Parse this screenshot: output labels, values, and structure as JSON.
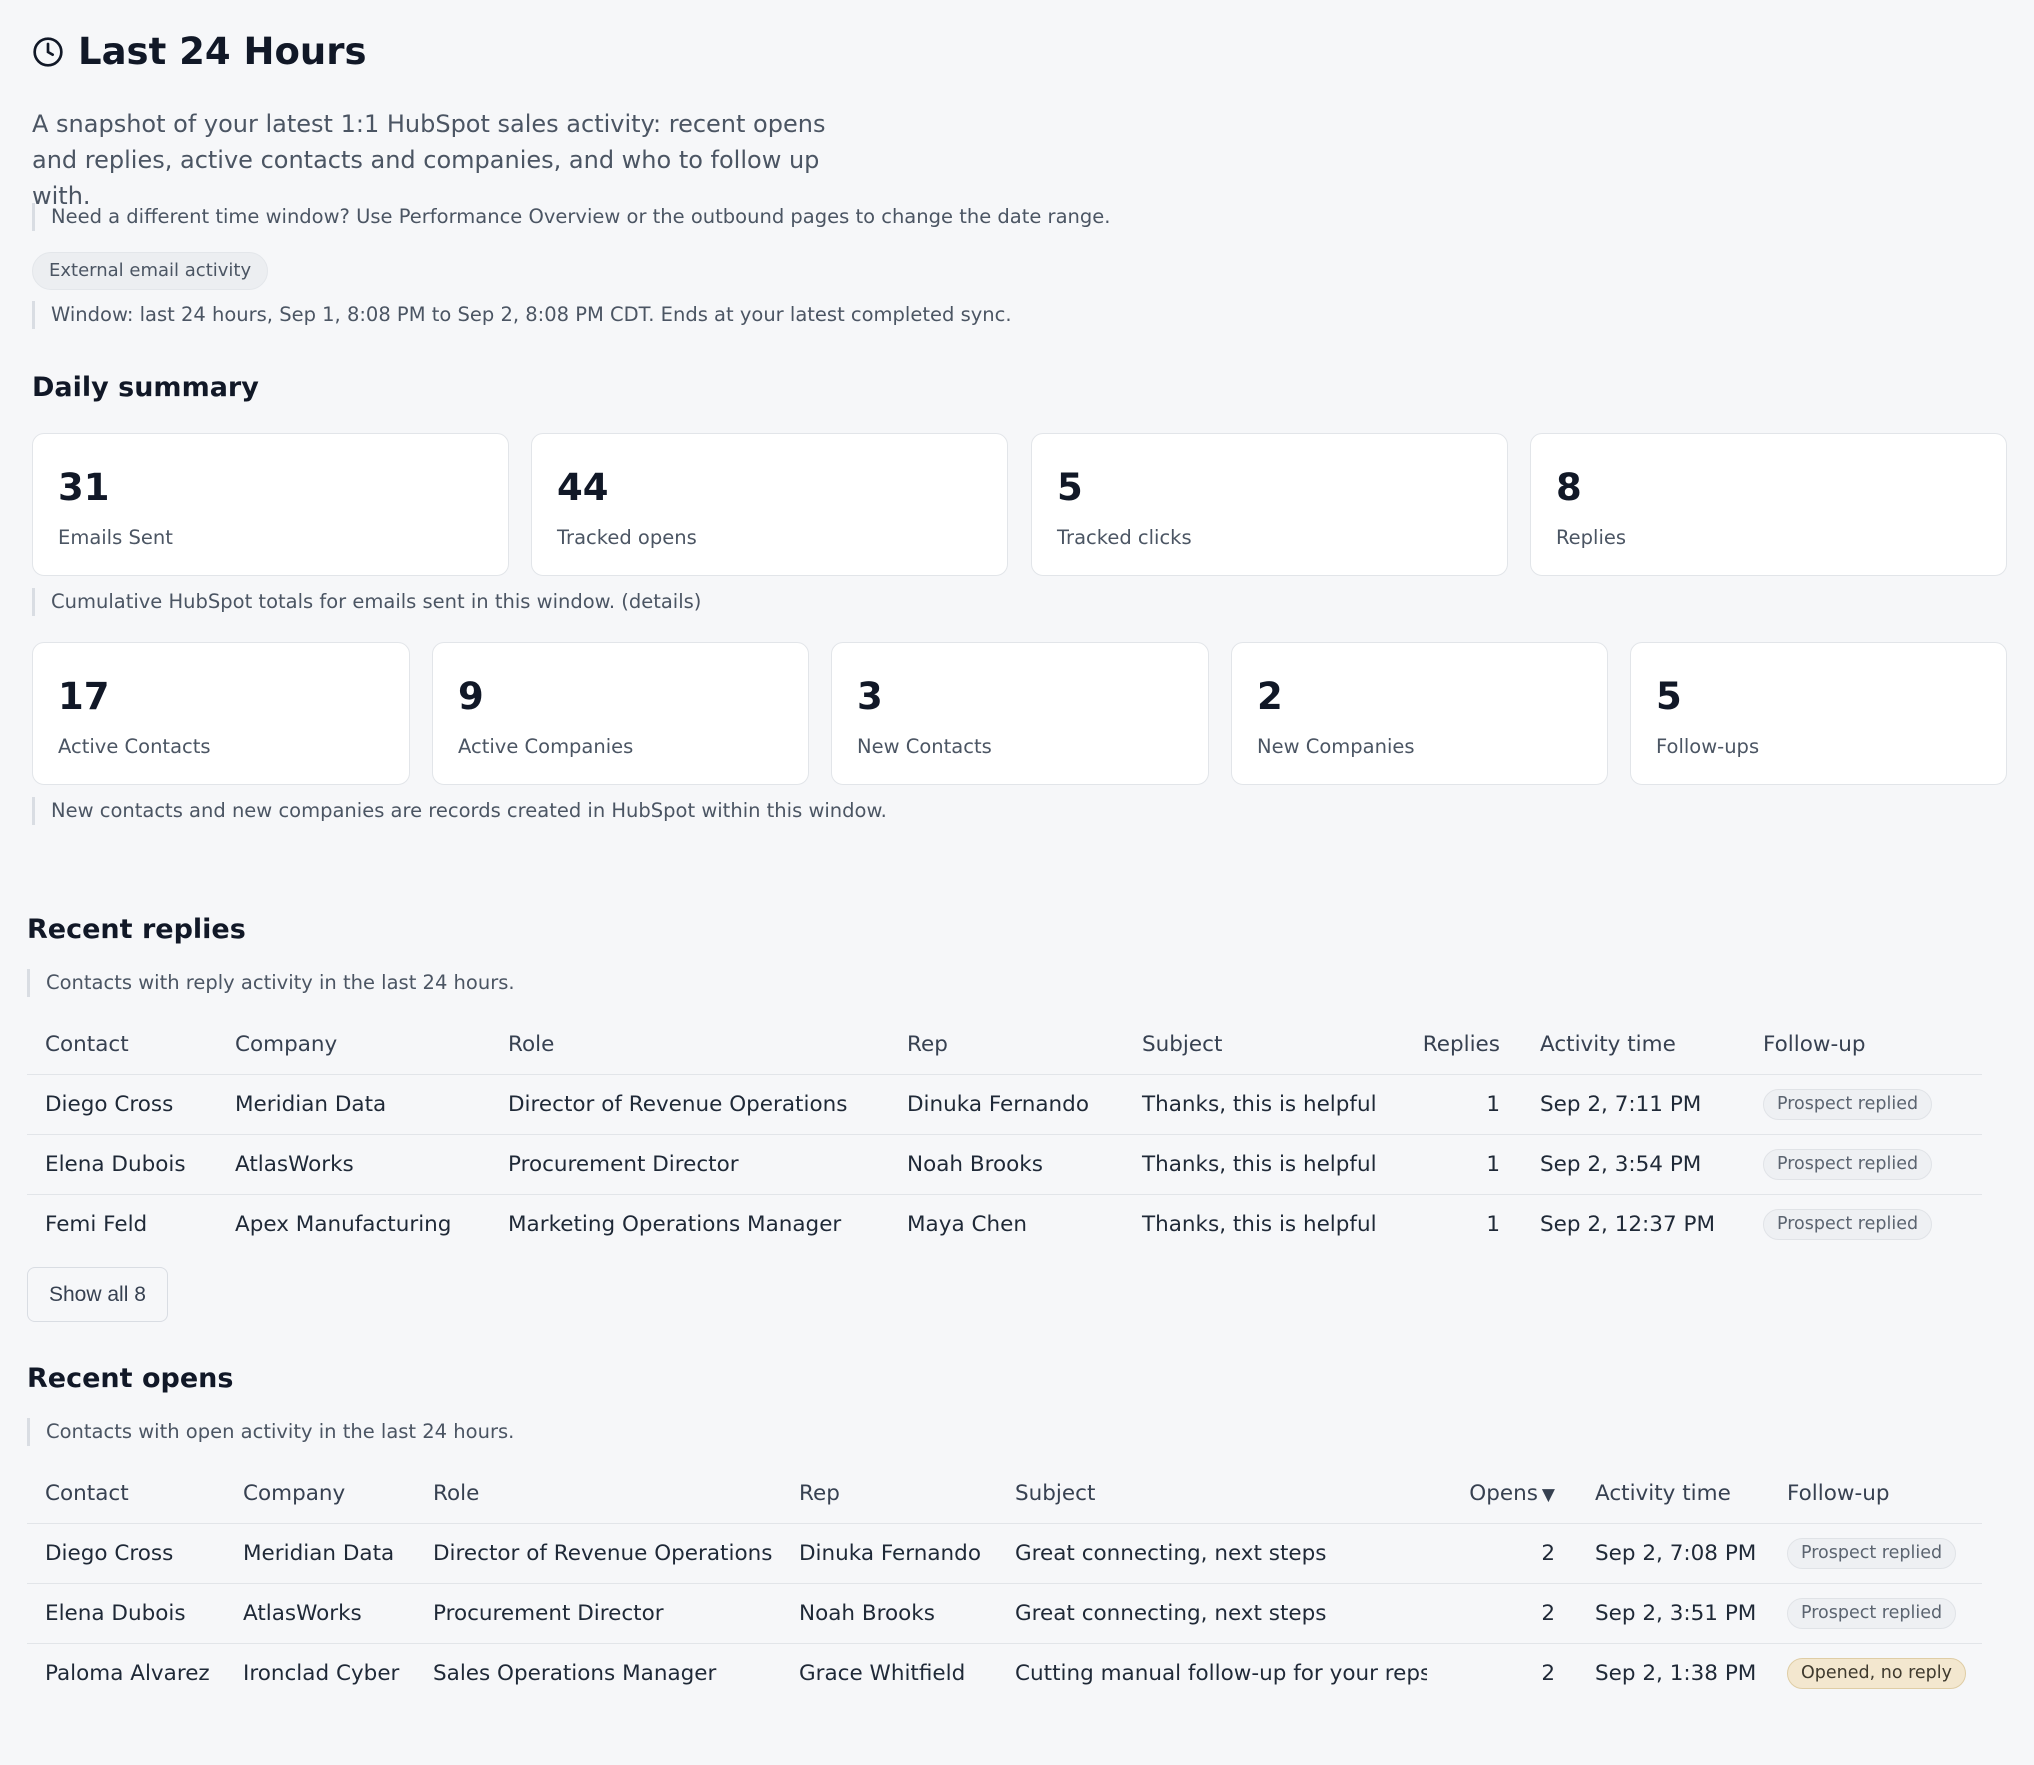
{
  "header": {
    "title": "Last 24 Hours",
    "icon": "clock-icon",
    "intro": "A snapshot of your latest 1:1 HubSpot sales activity: recent opens and replies, active contacts and companies, and who to follow up with.",
    "time_window_note": "Need a different time window? Use Performance Overview or the outbound pages to change the date range.",
    "tag": "External email activity",
    "window_note": "Window: last 24 hours, Sep 1, 8:08 PM to Sep 2, 8:08 PM CDT. Ends at your latest completed sync."
  },
  "daily_summary": {
    "title": "Daily summary",
    "row1": [
      {
        "value": "31",
        "label": "Emails Sent"
      },
      {
        "value": "44",
        "label": "Tracked opens"
      },
      {
        "value": "5",
        "label": "Tracked clicks"
      },
      {
        "value": "8",
        "label": "Replies"
      }
    ],
    "row1_note": "Cumulative HubSpot totals for emails sent in this window. (details)",
    "row2": [
      {
        "value": "17",
        "label": "Active Contacts"
      },
      {
        "value": "9",
        "label": "Active Companies"
      },
      {
        "value": "3",
        "label": "New Contacts"
      },
      {
        "value": "2",
        "label": "New Companies"
      },
      {
        "value": "5",
        "label": "Follow-ups"
      }
    ],
    "row2_note": "New contacts and new companies are records created in HubSpot within this window."
  },
  "recent_replies": {
    "title": "Recent replies",
    "note": "Contacts with reply activity in the last 24 hours.",
    "columns": [
      "Contact",
      "Company",
      "Role",
      "Rep",
      "Subject",
      "Replies",
      "Activity time",
      "Follow-up"
    ],
    "rows": [
      {
        "contact": "Diego Cross",
        "company": "Meridian Data",
        "role": "Director of Revenue Operations",
        "rep": "Dinuka Fernando",
        "subject": "Thanks, this is helpful",
        "count": "1",
        "time": "Sep 2, 7:11 PM",
        "followup": "Prospect replied"
      },
      {
        "contact": "Elena Dubois",
        "company": "AtlasWorks",
        "role": "Procurement Director",
        "rep": "Noah Brooks",
        "subject": "Thanks, this is helpful",
        "count": "1",
        "time": "Sep 2, 3:54 PM",
        "followup": "Prospect replied"
      },
      {
        "contact": "Femi Feld",
        "company": "Apex Manufacturing",
        "role": "Marketing Operations Manager",
        "rep": "Maya Chen",
        "subject": "Thanks, this is helpful",
        "count": "1",
        "time": "Sep 2, 12:37 PM",
        "followup": "Prospect replied"
      }
    ],
    "show_all_label": "Show all 8"
  },
  "recent_opens": {
    "title": "Recent opens",
    "note": "Contacts with open activity in the last 24 hours.",
    "columns": [
      "Contact",
      "Company",
      "Role",
      "Rep",
      "Subject",
      "Opens",
      "Activity time",
      "Follow-up"
    ],
    "sort_indicator": "▼",
    "rows": [
      {
        "contact": "Diego Cross",
        "company": "Meridian Data",
        "role": "Director of Revenue Operations",
        "rep": "Dinuka Fernando",
        "subject": "Great connecting, next steps",
        "count": "2",
        "time": "Sep 2, 7:08 PM",
        "followup": "Prospect replied"
      },
      {
        "contact": "Elena Dubois",
        "company": "AtlasWorks",
        "role": "Procurement Director",
        "rep": "Noah Brooks",
        "subject": "Great connecting, next steps",
        "count": "2",
        "time": "Sep 2, 3:51 PM",
        "followup": "Prospect replied"
      },
      {
        "contact": "Paloma Alvarez",
        "company": "Ironclad Cyber",
        "role": "Sales Operations Manager",
        "rep": "Grace Whitfield",
        "subject": "Cutting manual follow-up for your reps",
        "count": "2",
        "time": "Sep 2, 1:38 PM",
        "followup": "Opened, no reply"
      }
    ]
  },
  "colors": {
    "background": "#f6f7f9",
    "card": "#ffffff",
    "warn_badge": "#f3e7cf"
  }
}
